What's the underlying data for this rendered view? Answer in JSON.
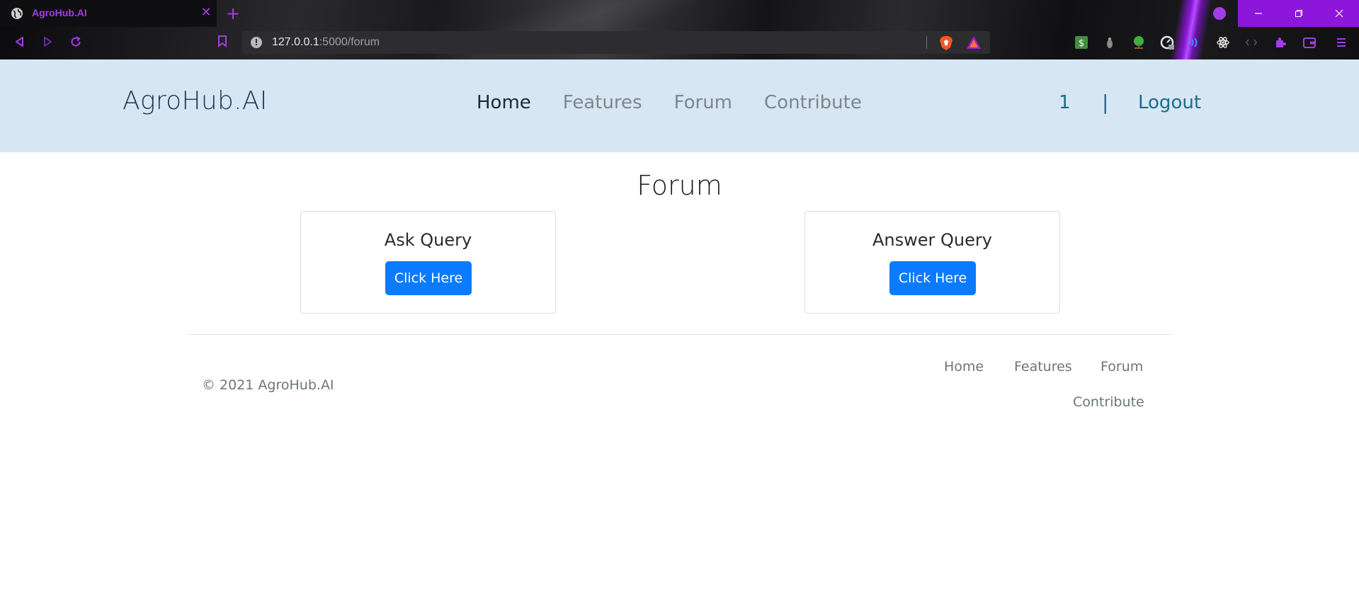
{
  "browser": {
    "tab_title": "AgroHub.AI",
    "url_host": "127.0.0.1",
    "url_rest": ":5000/forum",
    "accent_color": "#a23ce8",
    "window_controls_color": "#8c16da",
    "icons": [
      "globe-icon",
      "close-icon",
      "plus-icon",
      "back-icon",
      "forward-icon",
      "reload-icon",
      "bookmark-icon",
      "info-icon",
      "brave-shield-icon",
      "brave-rewards-icon",
      "minimize-icon",
      "restore-icon",
      "window-close-icon",
      "menu-icon",
      "extensions-icon",
      "wallet-icon"
    ]
  },
  "header": {
    "brand": "AgroHub.AI",
    "nav": [
      "Home",
      "Features",
      "Forum",
      "Contribute"
    ],
    "active_nav": "Home",
    "user_count": "1",
    "separator": "|",
    "logout": "Logout",
    "background": "#d6e6f3"
  },
  "main": {
    "title": "Forum",
    "cards": [
      {
        "title": "Ask Query",
        "button": "Click Here"
      },
      {
        "title": "Answer Query",
        "button": "Click Here"
      }
    ],
    "button_color": "#0a7bff"
  },
  "footer": {
    "copyright": "© 2021 AgroHub.AI",
    "links": [
      "Home",
      "Features",
      "Forum",
      "Contribute"
    ]
  }
}
